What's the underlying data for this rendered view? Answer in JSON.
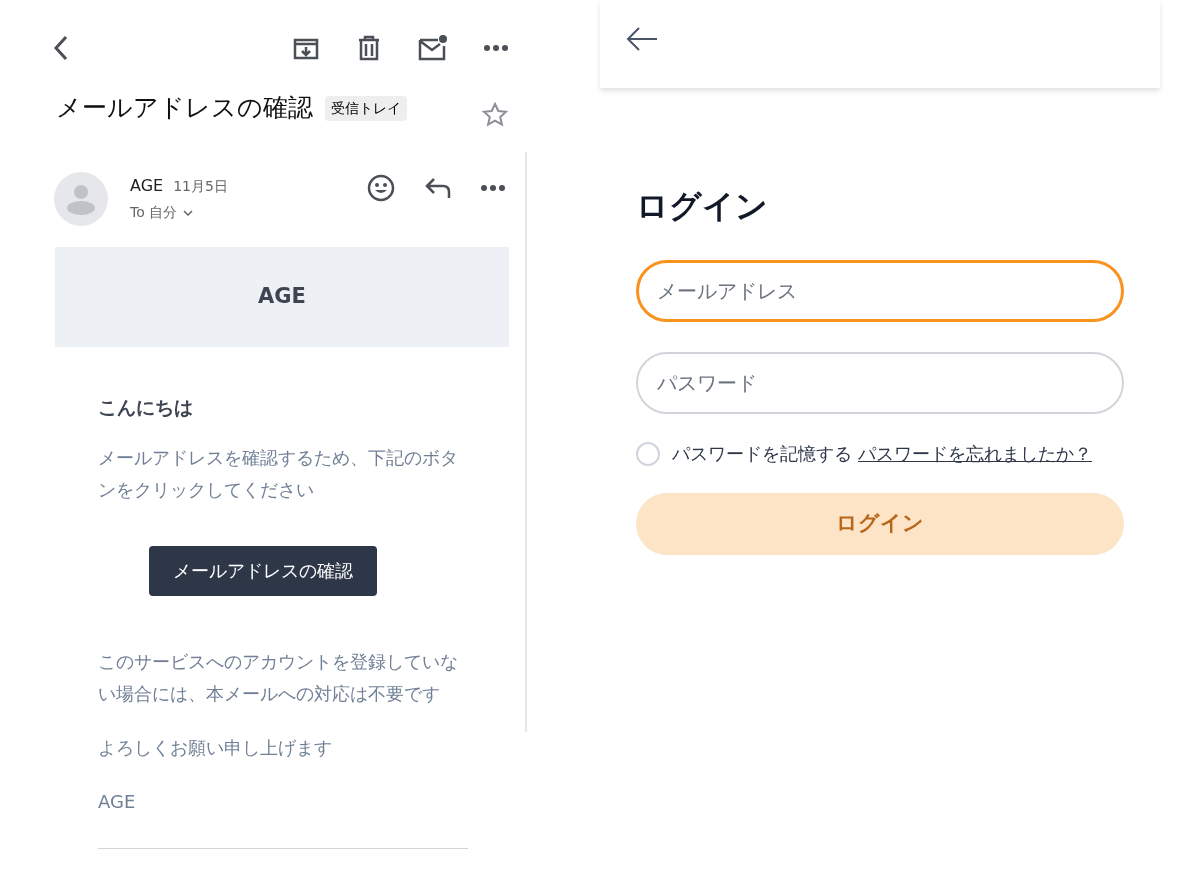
{
  "email": {
    "subject": "メールアドレスの確認",
    "label": "受信トレイ",
    "starred": false,
    "sender": {
      "name": "AGE",
      "date": "11月5日",
      "recipient": "To 自分"
    },
    "banner": "AGE",
    "greeting": "こんにちは",
    "paragraphs": [
      "メールアドレスを確認するため、下記のボタンをクリックしてください"
    ],
    "button": "メールアドレスの確認",
    "closing": [
      "このサービスへのアカウントを登録していない場合には、本メールへの対応は不要です",
      "よろしくお願い申し上げます",
      "AGE"
    ]
  },
  "login": {
    "title": "ログイン",
    "fields": [
      {
        "placeholder": "メールアドレス",
        "focused": true
      },
      {
        "placeholder": "パスワード",
        "focused": false
      }
    ],
    "remember": {
      "label": "パスワードを記憶する",
      "checked": false
    },
    "forgot_link": "パスワードを忘れましたか？",
    "submit": {
      "label": "ログイン",
      "disabled": true
    }
  }
}
